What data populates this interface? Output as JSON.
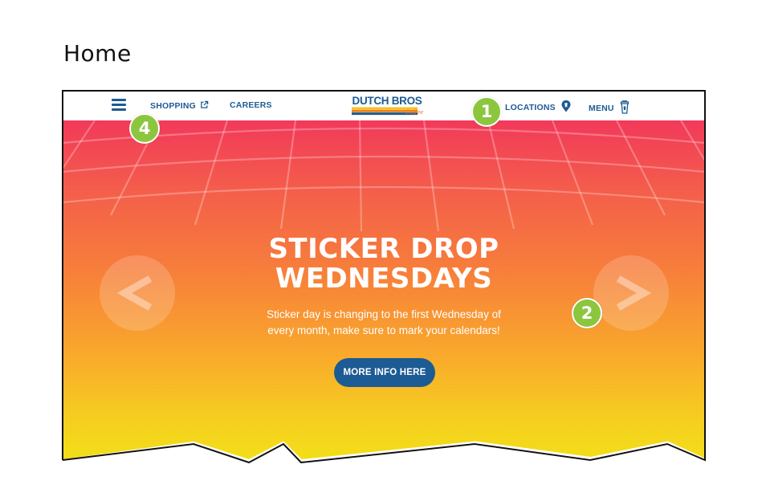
{
  "page_heading": "Home",
  "nav": {
    "shopping": "SHOPPING",
    "careers": "CAREERS",
    "locations": "LOCATIONS",
    "menu": "MENU"
  },
  "logo": {
    "top": "DUTCH BROS",
    "bottom": "Coffee"
  },
  "hero": {
    "title_line1": "STICKER DROP",
    "title_line2": "WEDNESDAYS",
    "subtitle_line1": "Sticker day is changing to the first Wednesday of",
    "subtitle_line2": "every month, make sure to mark your calendars!",
    "cta": "MORE INFO HERE",
    "prev": "<",
    "next": ">"
  },
  "callouts": {
    "c1": "1",
    "c2": "2",
    "c4": "4"
  },
  "icons": {
    "hamburger": "menu-icon",
    "shopping": "external-link-icon",
    "locations": "location-pin-icon",
    "menu": "cup-icon"
  },
  "colors": {
    "brand_blue": "#1c5b94",
    "callout_green": "#8cc63f",
    "logo_yellow": "#f5c31b",
    "logo_orange": "#ef7d22",
    "gradient_top": "#f2395a",
    "gradient_bottom": "#f2df18"
  }
}
